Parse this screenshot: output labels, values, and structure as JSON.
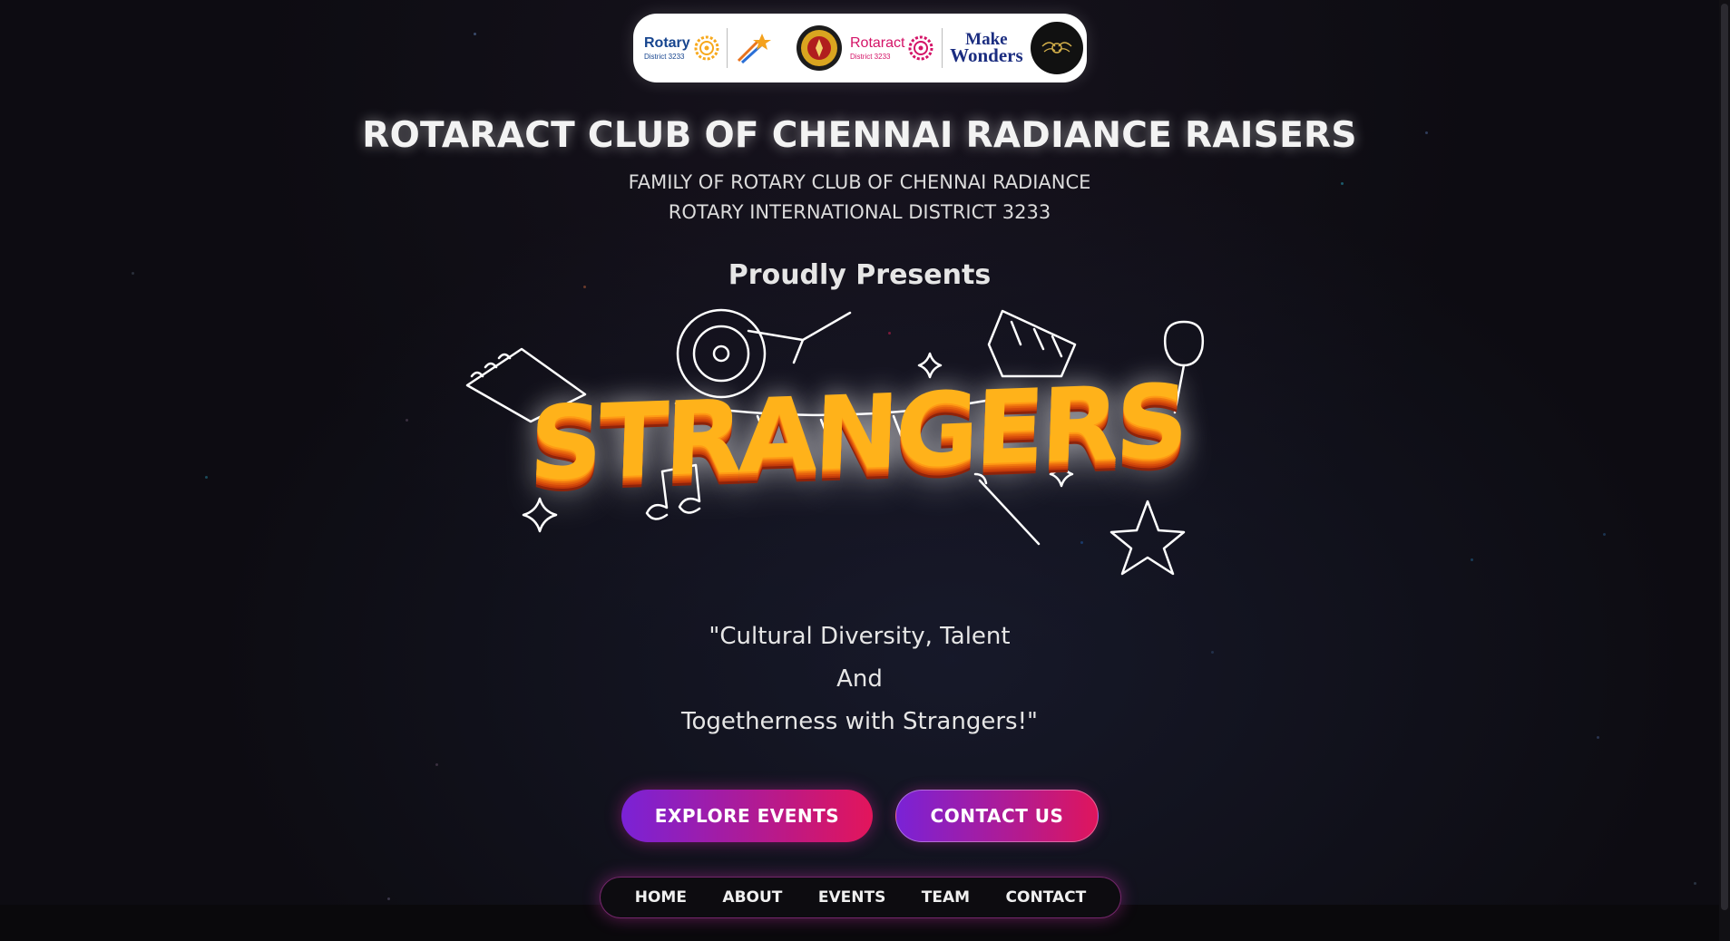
{
  "logos": {
    "rotary": {
      "name": "Rotary",
      "sub": "District 3233"
    },
    "magic": {
      "name": "THE MAGIC OF ROTARY"
    },
    "rotaract": {
      "name": "Rotaract",
      "sub": "District 3233"
    },
    "make_wonders": {
      "line1": "Make",
      "line2": "Wonders"
    }
  },
  "header": {
    "club_title": "ROTARACT CLUB OF CHENNAI RADIANCE RAISERS",
    "family_line": "FAMILY OF ROTARY CLUB OF CHENNAI RADIANCE",
    "district_line": "ROTARY INTERNATIONAL DISTRICT 3233",
    "presents": "Proudly Presents"
  },
  "hero": {
    "event_name": "STRANGERS"
  },
  "tagline": {
    "line1": "\"Cultural Diversity, Talent",
    "line2": "And",
    "line3": "Togetherness with Strangers!\""
  },
  "actions": {
    "explore_label": "EXPLORE EVENTS",
    "contact_label": "CONTACT US"
  },
  "nav": {
    "items": [
      "HOME",
      "ABOUT",
      "EVENTS",
      "TEAM",
      "CONTACT"
    ]
  },
  "colors": {
    "background": "#0d0c12",
    "accent_purple": "#7a22d6",
    "accent_pink": "#e3155b",
    "title_orange": "#ffb21a"
  }
}
